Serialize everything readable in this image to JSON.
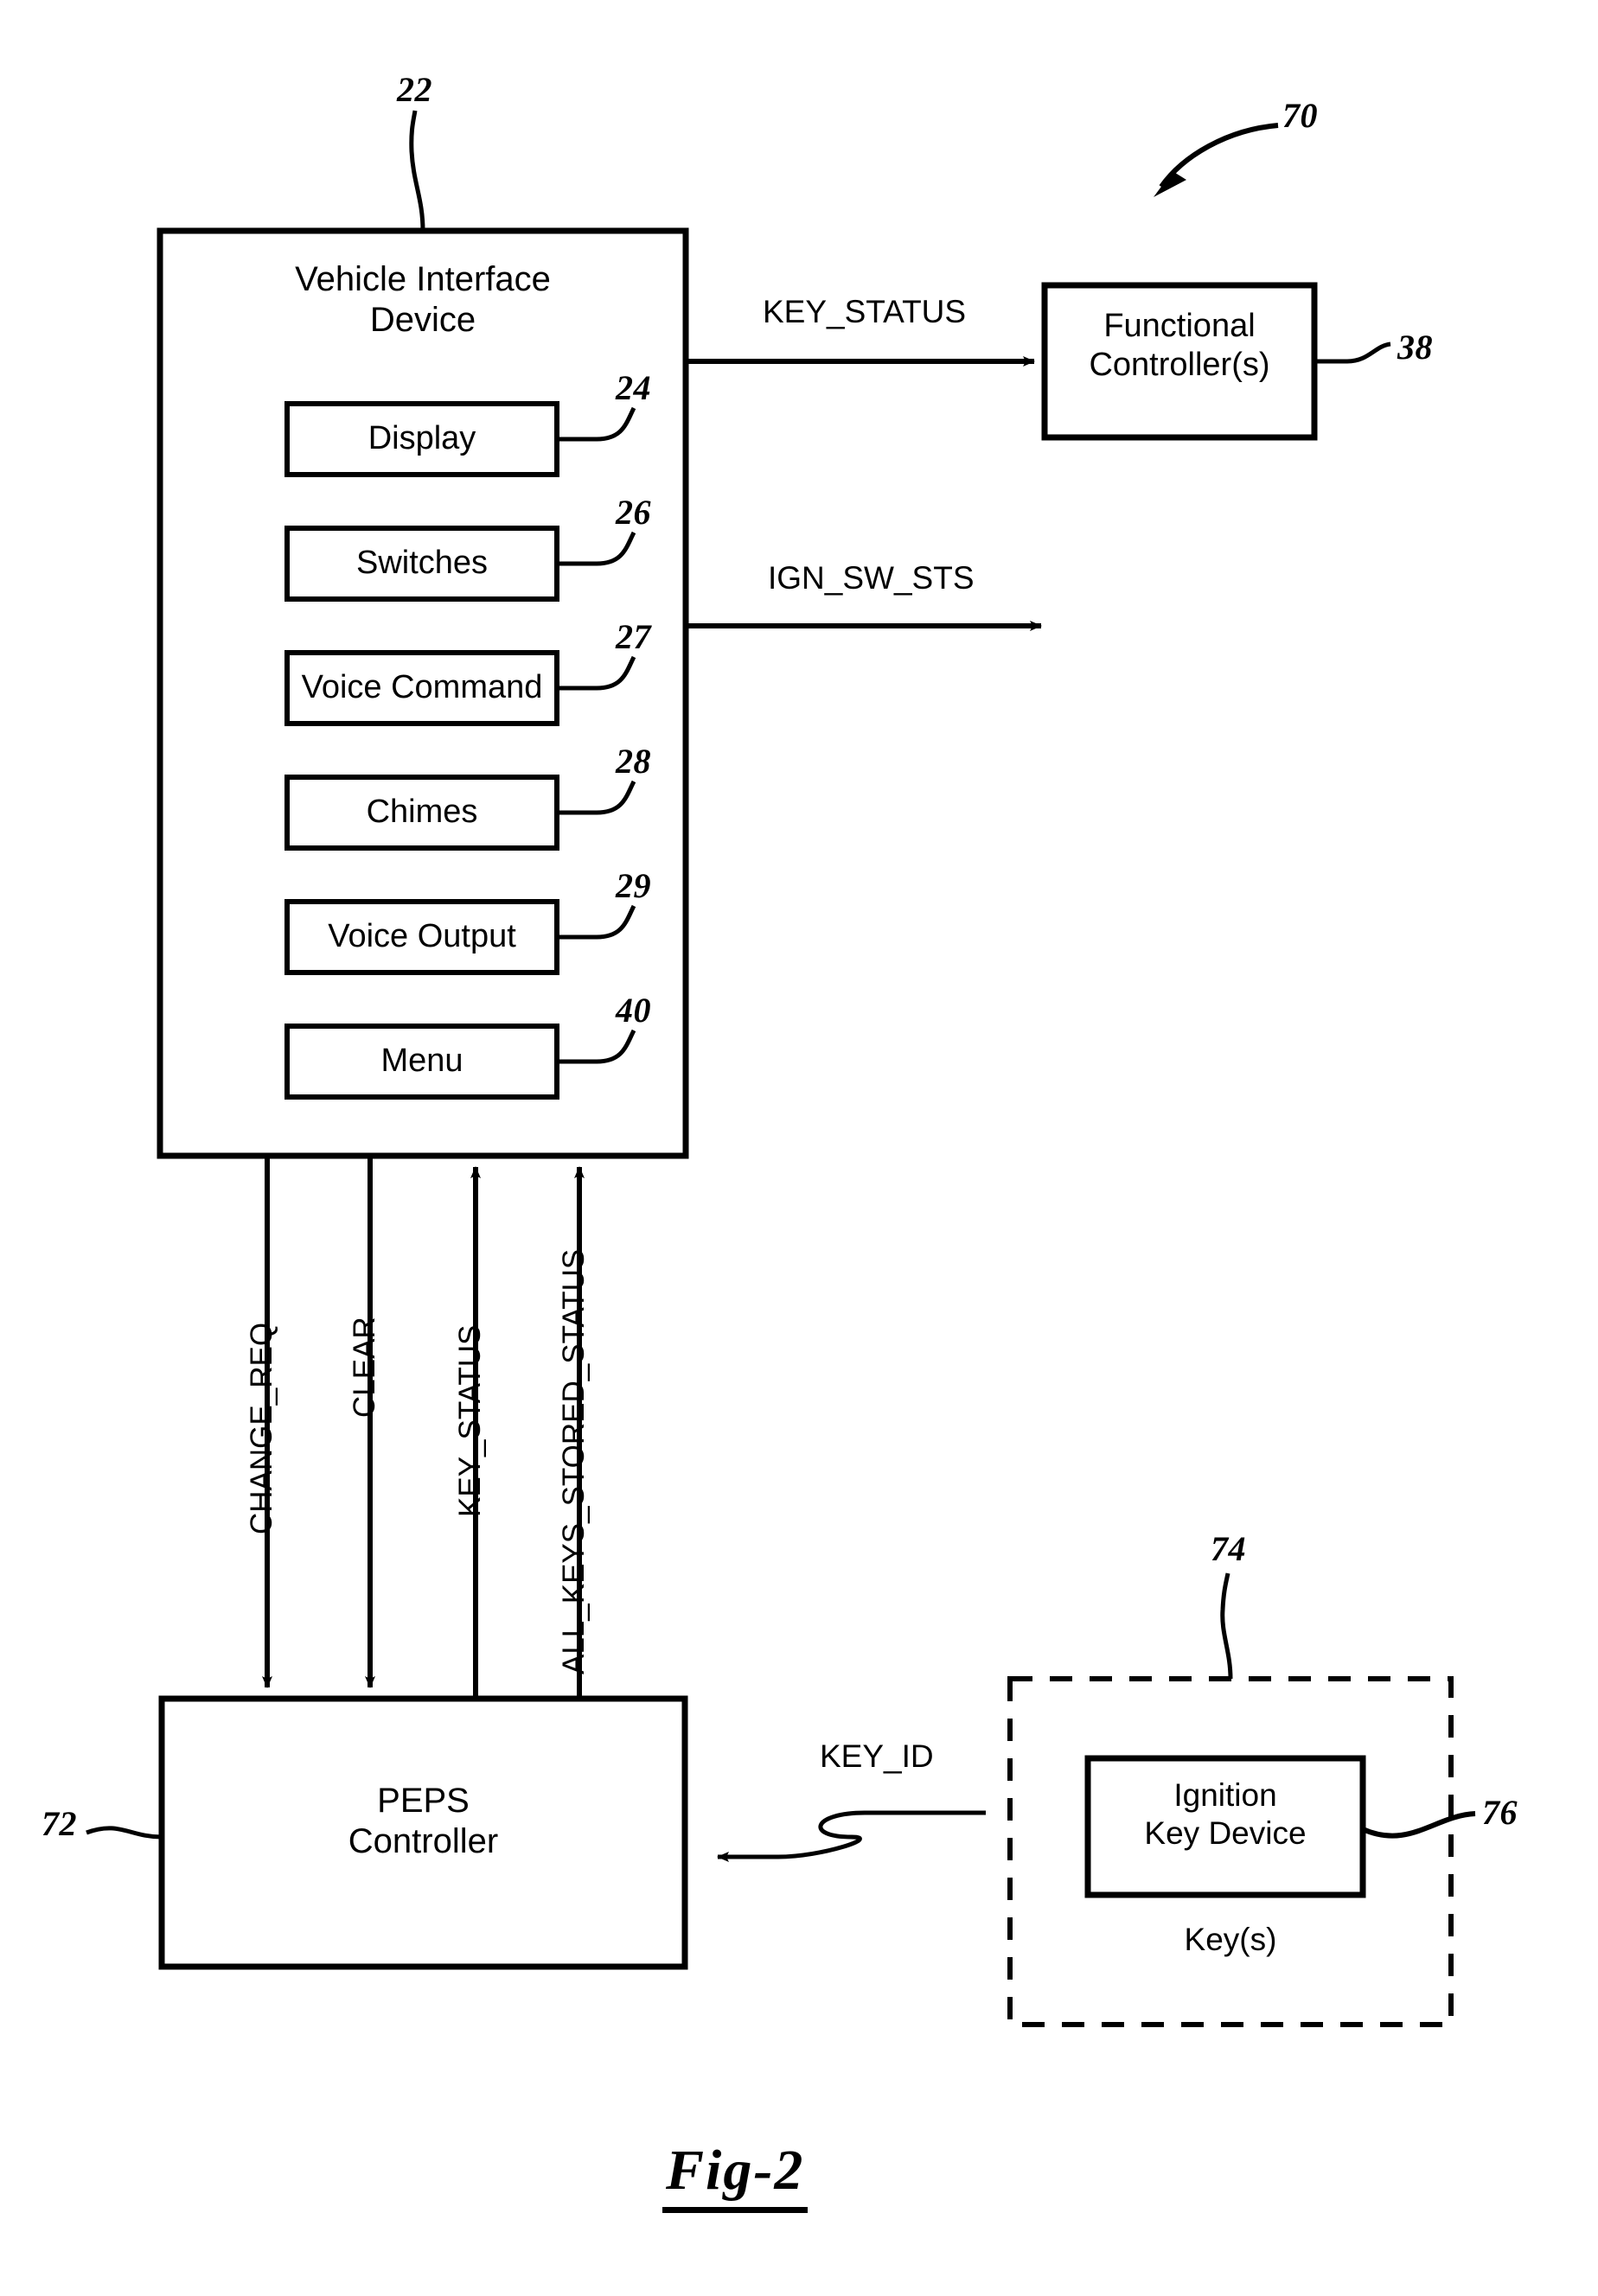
{
  "figure": {
    "caption": "Fig-2",
    "system_ref": "70"
  },
  "vehicle_interface_device": {
    "title": "Vehicle Interface\nDevice",
    "ref": "22",
    "modules": [
      {
        "label": "Display",
        "ref": "24"
      },
      {
        "label": "Switches",
        "ref": "26"
      },
      {
        "label": "Voice Command",
        "ref": "27"
      },
      {
        "label": "Chimes",
        "ref": "28"
      },
      {
        "label": "Voice Output",
        "ref": "29"
      },
      {
        "label": "Menu",
        "ref": "40"
      }
    ]
  },
  "functional_controller": {
    "label": "Functional\nController(s)",
    "ref": "38"
  },
  "peps_controller": {
    "label": "PEPS\nController",
    "ref": "72"
  },
  "keys_group": {
    "label": "Key(s)",
    "ref": "74",
    "ignition_key_device": {
      "label": "Ignition\nKey Device",
      "ref": "76"
    }
  },
  "signals": {
    "key_status_out": "KEY_STATUS",
    "ign_sw_sts": "IGN_SW_STS",
    "key_id": "KEY_ID",
    "vertical": [
      {
        "name": "CHANGE_REQ",
        "direction": "down"
      },
      {
        "name": "CLEAR",
        "direction": "down"
      },
      {
        "name": "KEY_STATUS",
        "direction": "up"
      },
      {
        "name": "ALL_KEYS_STORED_STATUS",
        "direction": "up"
      }
    ]
  },
  "colors": {
    "ink": "#000000",
    "paper": "#ffffff"
  }
}
